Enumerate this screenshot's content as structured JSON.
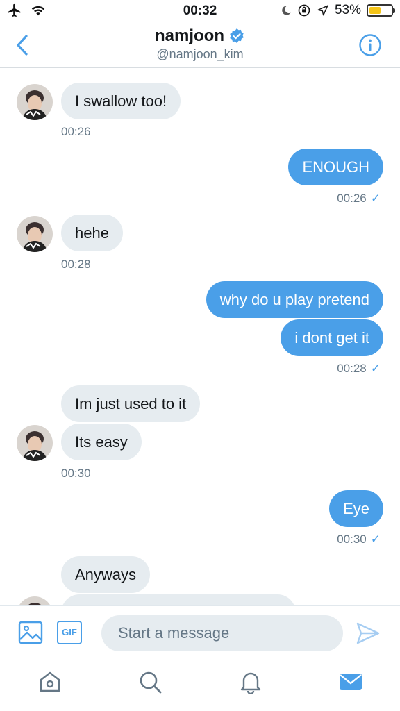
{
  "status_bar": {
    "time": "00:32",
    "battery_text": "53%",
    "battery_level": 0.53,
    "icons": [
      "airplane-icon",
      "wifi-icon",
      "moon-icon",
      "orientation-lock-icon",
      "location-icon",
      "battery-icon"
    ]
  },
  "header": {
    "name": "namjoon",
    "handle": "@namjoon_kim",
    "verified": true,
    "back_icon": "chevron-left-icon",
    "info_icon": "info-icon"
  },
  "messages": [
    {
      "direction": "in",
      "text": "I swallow too!"
    },
    {
      "direction": "in-time",
      "text": "00:26"
    },
    {
      "direction": "out",
      "text": "ENOUGH"
    },
    {
      "direction": "out-time",
      "text": "00:26"
    },
    {
      "direction": "in",
      "text": "hehe"
    },
    {
      "direction": "in-time",
      "text": "00:28"
    },
    {
      "direction": "out",
      "text": "why do u play pretend"
    },
    {
      "direction": "out",
      "text": "i dont get it"
    },
    {
      "direction": "out-time",
      "text": "00:28"
    },
    {
      "direction": "in",
      "text": "Im just used to it"
    },
    {
      "direction": "in",
      "text": "Its easy"
    },
    {
      "direction": "in-time",
      "text": "00:30"
    },
    {
      "direction": "out",
      "text": "Eye"
    },
    {
      "direction": "out-time",
      "text": "00:30"
    },
    {
      "direction": "in",
      "text": "Anyways"
    }
  ],
  "read_tick": "✓",
  "composer": {
    "placeholder": "Start a message",
    "gif_label": "GIF"
  },
  "tabs": [
    "home-icon",
    "search-icon",
    "notifications-icon",
    "messages-icon"
  ],
  "colors": {
    "accent": "#4a9fe8",
    "incoming_bubble": "#e6ecf0",
    "muted_text": "#657786"
  }
}
